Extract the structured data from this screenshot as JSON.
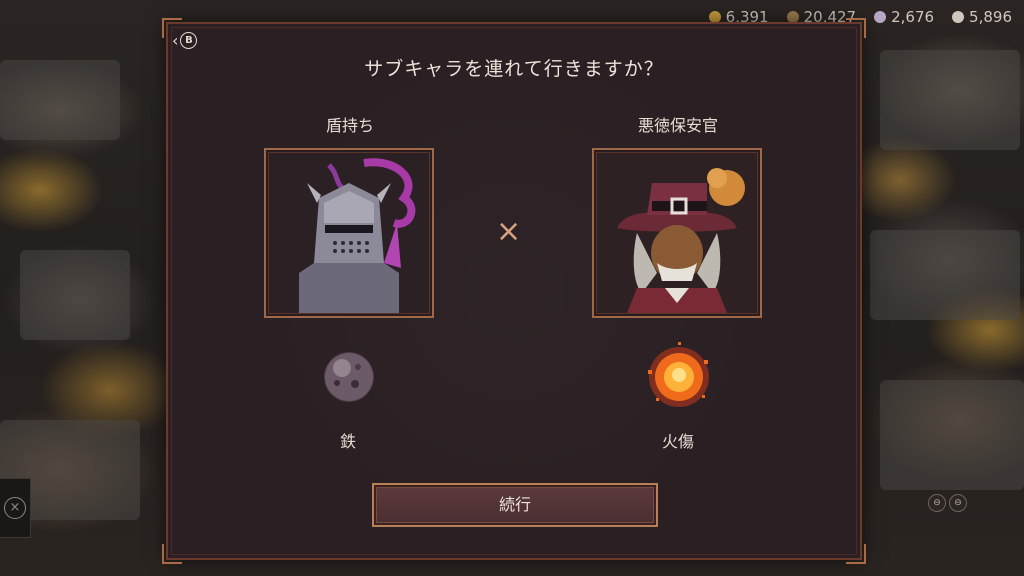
{
  "resources": [
    {
      "icon": "gold-icon",
      "value": "6,391",
      "color": "#c69a3c"
    },
    {
      "icon": "wood-icon",
      "value": "20,427",
      "color": "#9a7b4a"
    },
    {
      "icon": "gem-icon",
      "value": "2,676",
      "color": "#b9a7c7"
    },
    {
      "icon": "soul-icon",
      "value": "5,896",
      "color": "#cfc6bd"
    }
  ],
  "dialog": {
    "back_button": {
      "chevron": "‹",
      "key": "B"
    },
    "title": "サブキャラを連れて行きますか？",
    "left": {
      "name": "盾持ち",
      "effect": "鉄",
      "portrait": "armored-knight-portrait",
      "orb": "iron-orb-icon"
    },
    "right": {
      "name": "悪徳保安官",
      "effect": "火傷",
      "portrait": "sheriff-portrait",
      "orb": "fire-orb-icon"
    },
    "separator": "×",
    "continue_label": "続行"
  },
  "side": {
    "left_close": "×",
    "right_buttons": [
      "⊖",
      "⊖"
    ]
  },
  "colors": {
    "frame": "#a0684a",
    "panel": "#2a2023",
    "accent": "#d9a27f"
  }
}
